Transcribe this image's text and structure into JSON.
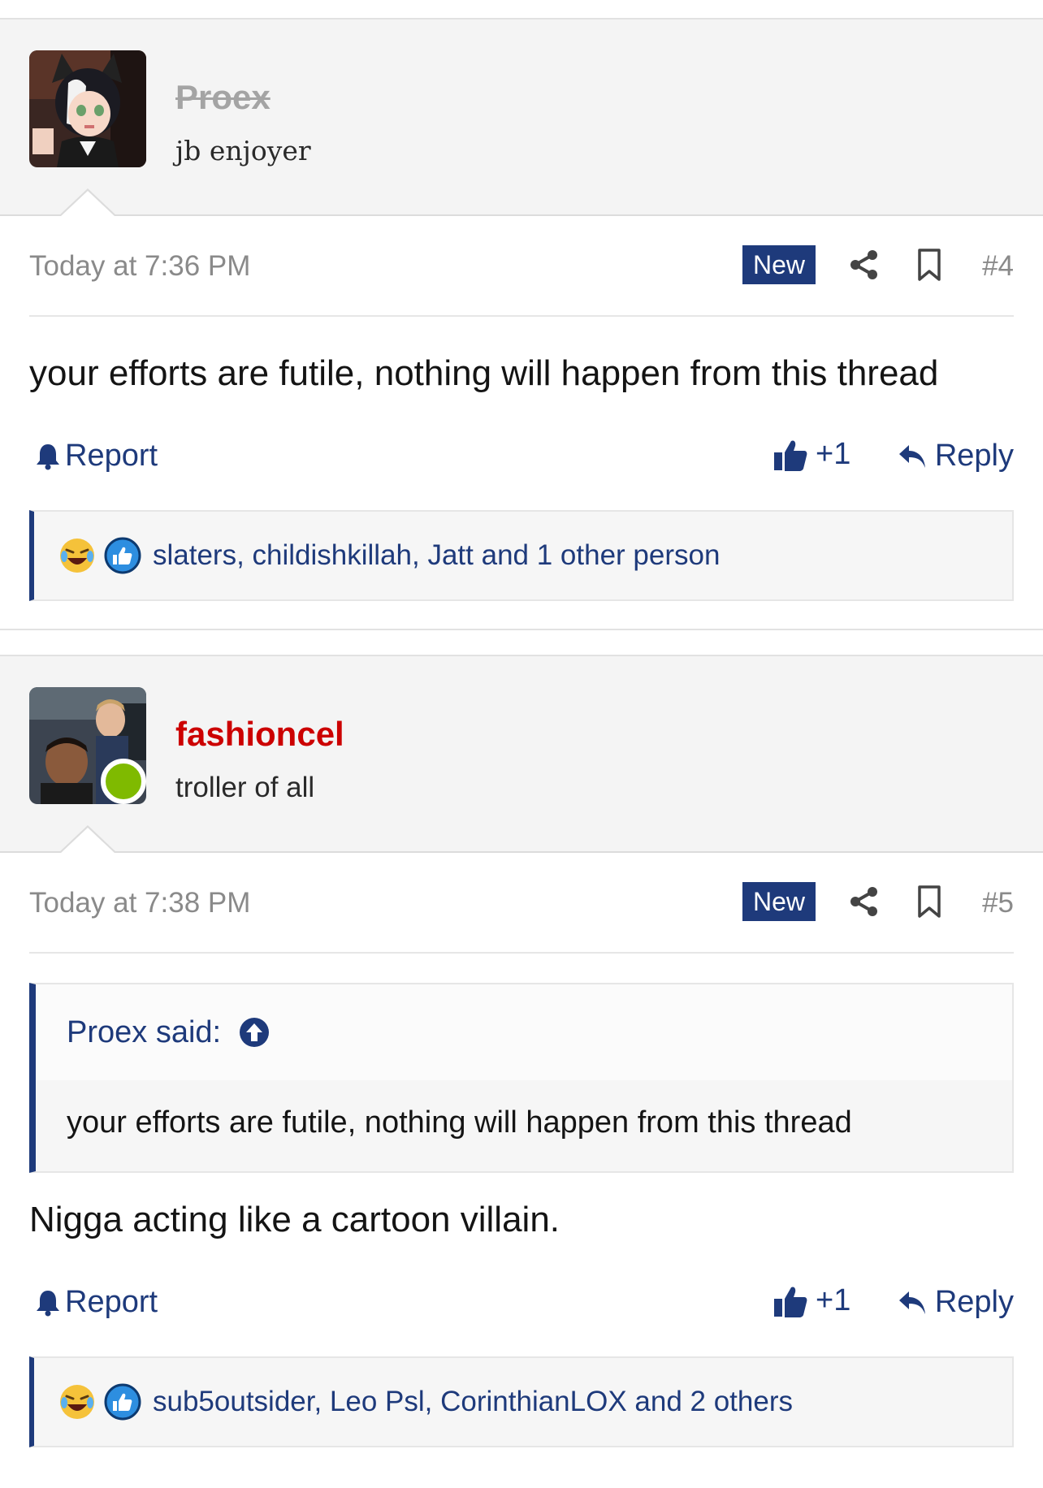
{
  "posts": [
    {
      "username": "Proex",
      "user_title": "jb enjoyer",
      "date": "Today at 7:36 PM",
      "new_badge": "New",
      "post_number": "#4",
      "message": "your efforts are futile, nothing will happen from this thread",
      "report_label": "Report",
      "like_label": "+1",
      "reply_label": "Reply",
      "reactions_text": "slaters, childishkillah, Jatt and 1 other person",
      "online": false
    },
    {
      "username": "fashioncel",
      "user_title": "troller of all",
      "date": "Today at 7:38 PM",
      "new_badge": "New",
      "post_number": "#5",
      "quote": {
        "author": "Proex said:",
        "text": "your efforts are futile, nothing will happen from this thread"
      },
      "message": "Nigga acting like a cartoon villain.",
      "report_label": "Report",
      "like_label": "+1",
      "reply_label": "Reply",
      "reactions_text": "sub5outsider, Leo Psl, CorinthianLOX and 2 others",
      "online": true
    }
  ],
  "colors": {
    "accent": "#1e3a7b",
    "banned_username": "#a4a4a4",
    "staff_username": "#cc0000",
    "online": "#7fba00"
  },
  "icons": [
    "share-icon",
    "bookmark-icon",
    "bell-icon",
    "thumbs-up-icon",
    "reply-arrow-icon",
    "laughing-emoji-icon",
    "like-reaction-icon",
    "arrow-up-circle-icon"
  ]
}
